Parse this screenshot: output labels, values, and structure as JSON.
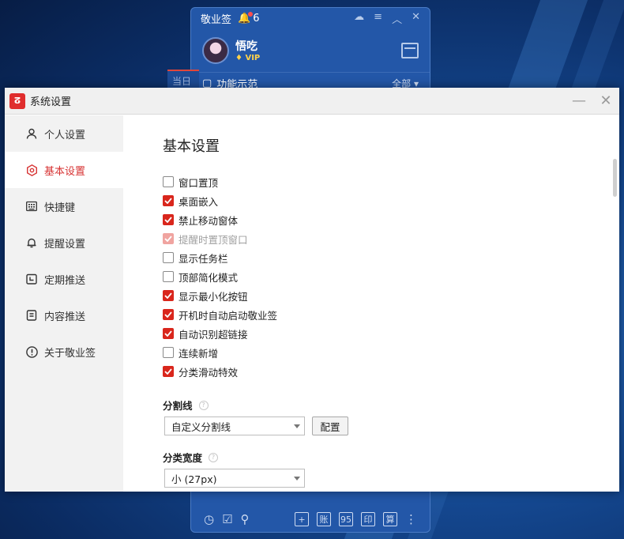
{
  "desktop": {
    "background": "#14478f"
  },
  "note_widget": {
    "title": "敬业签",
    "bell_count": "6",
    "username": "悟吃",
    "vip_label": "VIP",
    "section_title": "功能示范",
    "section_filter": "全部",
    "behind_tab": "当日",
    "bottom_buttons": [
      "+",
      "账",
      "95",
      "印",
      "算"
    ]
  },
  "dialog": {
    "title": "系统设置",
    "accent": "#d9261c",
    "sidebar": [
      {
        "label": "个人设置",
        "icon": "user-icon"
      },
      {
        "label": "基本设置",
        "icon": "target-icon",
        "active": true
      },
      {
        "label": "快捷键",
        "icon": "keyboard-icon"
      },
      {
        "label": "提醒设置",
        "icon": "bell-icon"
      },
      {
        "label": "定期推送",
        "icon": "calendar-push-icon"
      },
      {
        "label": "内容推送",
        "icon": "document-icon"
      },
      {
        "label": "关于敬业签",
        "icon": "info-icon"
      }
    ],
    "page_title": "基本设置",
    "options": [
      {
        "label": "窗口置顶",
        "checked": false,
        "disabled": false
      },
      {
        "label": "桌面嵌入",
        "checked": true,
        "disabled": false
      },
      {
        "label": "禁止移动窗体",
        "checked": true,
        "disabled": false
      },
      {
        "label": "提醒时置顶窗口",
        "checked": true,
        "disabled": true
      },
      {
        "label": "显示任务栏",
        "checked": false,
        "disabled": false
      },
      {
        "label": "顶部简化模式",
        "checked": false,
        "disabled": false
      },
      {
        "label": "显示最小化按钮",
        "checked": true,
        "disabled": false
      },
      {
        "label": "开机时自动启动敬业签",
        "checked": true,
        "disabled": false
      },
      {
        "label": "自动识别超链接",
        "checked": true,
        "disabled": false
      },
      {
        "label": "连续新增",
        "checked": false,
        "disabled": false
      },
      {
        "label": "分类滑动特效",
        "checked": true,
        "disabled": false
      }
    ],
    "divider": {
      "label": "分割线",
      "help": "?",
      "selected": "自定义分割线",
      "config_button": "配置"
    },
    "category_width": {
      "label": "分类宽度",
      "help": "?",
      "selected": "小 (27px)"
    }
  }
}
